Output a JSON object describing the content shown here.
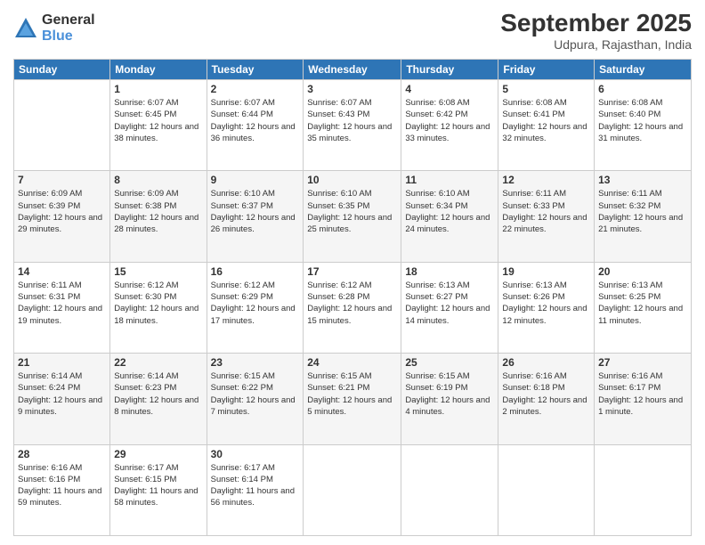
{
  "logo": {
    "general": "General",
    "blue": "Blue"
  },
  "header": {
    "month": "September 2025",
    "location": "Udpura, Rajasthan, India"
  },
  "weekdays": [
    "Sunday",
    "Monday",
    "Tuesday",
    "Wednesday",
    "Thursday",
    "Friday",
    "Saturday"
  ],
  "weeks": [
    [
      {
        "day": "",
        "sunrise": "",
        "sunset": "",
        "daylight": ""
      },
      {
        "day": "1",
        "sunrise": "Sunrise: 6:07 AM",
        "sunset": "Sunset: 6:45 PM",
        "daylight": "Daylight: 12 hours and 38 minutes."
      },
      {
        "day": "2",
        "sunrise": "Sunrise: 6:07 AM",
        "sunset": "Sunset: 6:44 PM",
        "daylight": "Daylight: 12 hours and 36 minutes."
      },
      {
        "day": "3",
        "sunrise": "Sunrise: 6:07 AM",
        "sunset": "Sunset: 6:43 PM",
        "daylight": "Daylight: 12 hours and 35 minutes."
      },
      {
        "day": "4",
        "sunrise": "Sunrise: 6:08 AM",
        "sunset": "Sunset: 6:42 PM",
        "daylight": "Daylight: 12 hours and 33 minutes."
      },
      {
        "day": "5",
        "sunrise": "Sunrise: 6:08 AM",
        "sunset": "Sunset: 6:41 PM",
        "daylight": "Daylight: 12 hours and 32 minutes."
      },
      {
        "day": "6",
        "sunrise": "Sunrise: 6:08 AM",
        "sunset": "Sunset: 6:40 PM",
        "daylight": "Daylight: 12 hours and 31 minutes."
      }
    ],
    [
      {
        "day": "7",
        "sunrise": "Sunrise: 6:09 AM",
        "sunset": "Sunset: 6:39 PM",
        "daylight": "Daylight: 12 hours and 29 minutes."
      },
      {
        "day": "8",
        "sunrise": "Sunrise: 6:09 AM",
        "sunset": "Sunset: 6:38 PM",
        "daylight": "Daylight: 12 hours and 28 minutes."
      },
      {
        "day": "9",
        "sunrise": "Sunrise: 6:10 AM",
        "sunset": "Sunset: 6:37 PM",
        "daylight": "Daylight: 12 hours and 26 minutes."
      },
      {
        "day": "10",
        "sunrise": "Sunrise: 6:10 AM",
        "sunset": "Sunset: 6:35 PM",
        "daylight": "Daylight: 12 hours and 25 minutes."
      },
      {
        "day": "11",
        "sunrise": "Sunrise: 6:10 AM",
        "sunset": "Sunset: 6:34 PM",
        "daylight": "Daylight: 12 hours and 24 minutes."
      },
      {
        "day": "12",
        "sunrise": "Sunrise: 6:11 AM",
        "sunset": "Sunset: 6:33 PM",
        "daylight": "Daylight: 12 hours and 22 minutes."
      },
      {
        "day": "13",
        "sunrise": "Sunrise: 6:11 AM",
        "sunset": "Sunset: 6:32 PM",
        "daylight": "Daylight: 12 hours and 21 minutes."
      }
    ],
    [
      {
        "day": "14",
        "sunrise": "Sunrise: 6:11 AM",
        "sunset": "Sunset: 6:31 PM",
        "daylight": "Daylight: 12 hours and 19 minutes."
      },
      {
        "day": "15",
        "sunrise": "Sunrise: 6:12 AM",
        "sunset": "Sunset: 6:30 PM",
        "daylight": "Daylight: 12 hours and 18 minutes."
      },
      {
        "day": "16",
        "sunrise": "Sunrise: 6:12 AM",
        "sunset": "Sunset: 6:29 PM",
        "daylight": "Daylight: 12 hours and 17 minutes."
      },
      {
        "day": "17",
        "sunrise": "Sunrise: 6:12 AM",
        "sunset": "Sunset: 6:28 PM",
        "daylight": "Daylight: 12 hours and 15 minutes."
      },
      {
        "day": "18",
        "sunrise": "Sunrise: 6:13 AM",
        "sunset": "Sunset: 6:27 PM",
        "daylight": "Daylight: 12 hours and 14 minutes."
      },
      {
        "day": "19",
        "sunrise": "Sunrise: 6:13 AM",
        "sunset": "Sunset: 6:26 PM",
        "daylight": "Daylight: 12 hours and 12 minutes."
      },
      {
        "day": "20",
        "sunrise": "Sunrise: 6:13 AM",
        "sunset": "Sunset: 6:25 PM",
        "daylight": "Daylight: 12 hours and 11 minutes."
      }
    ],
    [
      {
        "day": "21",
        "sunrise": "Sunrise: 6:14 AM",
        "sunset": "Sunset: 6:24 PM",
        "daylight": "Daylight: 12 hours and 9 minutes."
      },
      {
        "day": "22",
        "sunrise": "Sunrise: 6:14 AM",
        "sunset": "Sunset: 6:23 PM",
        "daylight": "Daylight: 12 hours and 8 minutes."
      },
      {
        "day": "23",
        "sunrise": "Sunrise: 6:15 AM",
        "sunset": "Sunset: 6:22 PM",
        "daylight": "Daylight: 12 hours and 7 minutes."
      },
      {
        "day": "24",
        "sunrise": "Sunrise: 6:15 AM",
        "sunset": "Sunset: 6:21 PM",
        "daylight": "Daylight: 12 hours and 5 minutes."
      },
      {
        "day": "25",
        "sunrise": "Sunrise: 6:15 AM",
        "sunset": "Sunset: 6:19 PM",
        "daylight": "Daylight: 12 hours and 4 minutes."
      },
      {
        "day": "26",
        "sunrise": "Sunrise: 6:16 AM",
        "sunset": "Sunset: 6:18 PM",
        "daylight": "Daylight: 12 hours and 2 minutes."
      },
      {
        "day": "27",
        "sunrise": "Sunrise: 6:16 AM",
        "sunset": "Sunset: 6:17 PM",
        "daylight": "Daylight: 12 hours and 1 minute."
      }
    ],
    [
      {
        "day": "28",
        "sunrise": "Sunrise: 6:16 AM",
        "sunset": "Sunset: 6:16 PM",
        "daylight": "Daylight: 11 hours and 59 minutes."
      },
      {
        "day": "29",
        "sunrise": "Sunrise: 6:17 AM",
        "sunset": "Sunset: 6:15 PM",
        "daylight": "Daylight: 11 hours and 58 minutes."
      },
      {
        "day": "30",
        "sunrise": "Sunrise: 6:17 AM",
        "sunset": "Sunset: 6:14 PM",
        "daylight": "Daylight: 11 hours and 56 minutes."
      },
      {
        "day": "",
        "sunrise": "",
        "sunset": "",
        "daylight": ""
      },
      {
        "day": "",
        "sunrise": "",
        "sunset": "",
        "daylight": ""
      },
      {
        "day": "",
        "sunrise": "",
        "sunset": "",
        "daylight": ""
      },
      {
        "day": "",
        "sunrise": "",
        "sunset": "",
        "daylight": ""
      }
    ]
  ]
}
